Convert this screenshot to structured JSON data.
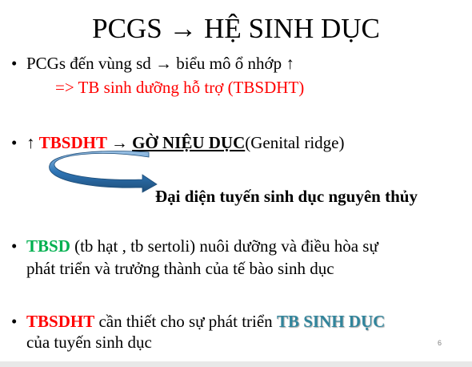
{
  "title": "PCGS → HỆ SINH DỤC",
  "bullet_symbol": "•",
  "b1": {
    "text": "PCGs đến vùng sd → biểu mô ổ nhớp ↑",
    "sub": "=> TB sinh dưỡng hỗ trợ (TBSDHT)"
  },
  "b2": {
    "prefix": "↑ ",
    "tbsdht": "TBSDHT",
    "arrow": " → ",
    "ridge": "GỜ NIỆU DỤC",
    "paren": "(Genital ridge)",
    "note": "Đại diện tuyến sinh dục nguyên thủy"
  },
  "b3": {
    "tbsd": "TBSD",
    "line1": " (tb hạt , tb sertoli) nuôi dưỡng và điều hòa sự",
    "line2": "phát triển và trưởng thành của tế bào sinh dục"
  },
  "b4": {
    "tbsdht": "TBSDHT",
    "mid": " cần thiết cho sự phát triển ",
    "tbsinhduc": "TB SINH DỤC",
    "line2": "của tuyến sinh dục"
  },
  "slide_number": "6",
  "colors": {
    "red": "#ff0000",
    "green": "#00b050",
    "teal": "#31859c",
    "arrow": "#2e75b6"
  }
}
